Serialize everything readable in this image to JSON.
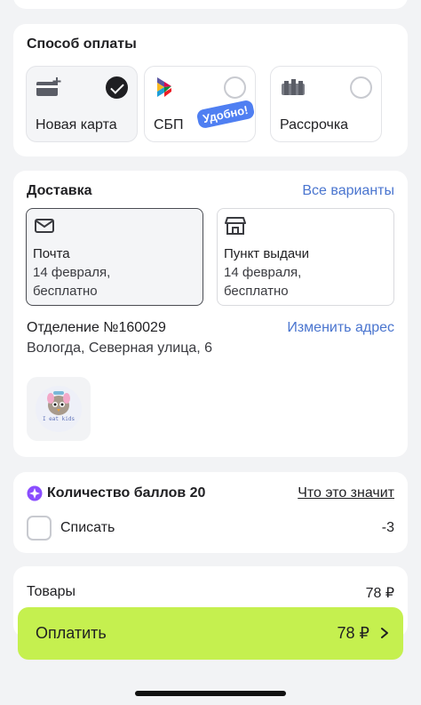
{
  "payment": {
    "title": "Способ оплаты",
    "options": [
      {
        "label": "Новая карта",
        "icon": "card-plus-icon",
        "selected": true
      },
      {
        "label": "СБП",
        "icon": "sbp-logo-icon",
        "selected": false,
        "badge": "Удобно!"
      },
      {
        "label": "Рассрочка",
        "icon": "installments-icon",
        "selected": false
      }
    ]
  },
  "delivery": {
    "title": "Доставка",
    "all_options_link": "Все варианты",
    "options": [
      {
        "name": "Почта",
        "date": "14 февраля,",
        "price": "бесплатно",
        "icon": "mail-icon",
        "selected": true
      },
      {
        "name": "Пункт выдачи",
        "date": "14 февраля,",
        "price": "бесплатно",
        "icon": "store-icon",
        "selected": false
      }
    ],
    "office": "Отделение №160029",
    "address": "Вологда, Северная улица, 6",
    "change_address_link": "Изменить адрес",
    "product_thumb_text": "I eat kids"
  },
  "points": {
    "title": "Количество баллов 20",
    "what_link": "Что это значит",
    "writeoff_label": "Списать",
    "writeoff_value": "-3"
  },
  "summary": {
    "goods_label": "Товары",
    "goods_value": "78 ₽"
  },
  "pay_button": {
    "label": "Оплатить",
    "amount": "78 ₽"
  },
  "colors": {
    "accent_green": "#c5f04f",
    "link_blue": "#4a75cf",
    "badge_blue": "#4f7ff2",
    "points_purple": "#8a4dff"
  }
}
